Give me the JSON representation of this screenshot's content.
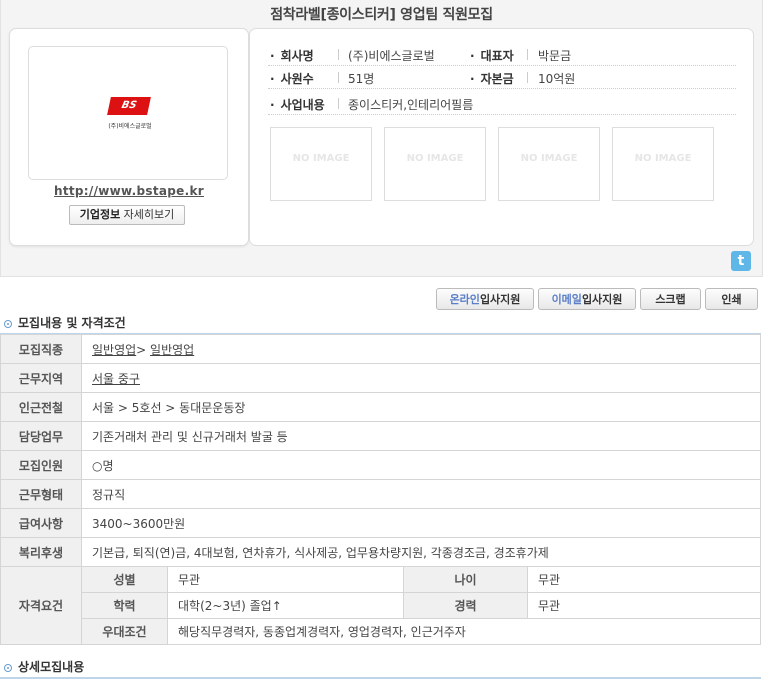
{
  "page": {
    "title": "점착라벨[종이스티커] 영업팀 직원모집"
  },
  "company": {
    "logo_mark": "BS",
    "logo_text": "(주)비에스글로벌",
    "homepage": "http://www.bstape.kr",
    "detail_button_bold": "기업정보",
    "detail_button_rest": " 자세히보기",
    "fields": [
      {
        "label": "회사명",
        "value": "(주)비에스글로벌"
      },
      {
        "label": "대표자",
        "value": "박문금"
      },
      {
        "label": "사원수",
        "value": "51명"
      },
      {
        "label": "자본금",
        "value": "10억원"
      },
      {
        "label": "사업내용",
        "value": "종이스티커,인테리어필름"
      }
    ],
    "no_image_text": "NO IMAGE"
  },
  "share": {
    "twitter_glyph": "t"
  },
  "actions": {
    "online_hl": "온라인",
    "online_rest": "입사지원",
    "email_hl": "이메일",
    "email_rest": "입사지원",
    "scrap": "스크랩",
    "print": "인쇄"
  },
  "sections": {
    "requirements_title": "모집내용 및 자격조건",
    "detail_title": "상세모집내용"
  },
  "requirements": {
    "job_label": "모집직종",
    "job_value_1": "일반영업",
    "job_sep": "> ",
    "job_value_2": "일반영업",
    "location_label": "근무지역",
    "location_value": "서울 중구",
    "station_label": "인근전철",
    "station_value": "서울 > 5호선 > 동대문운동장",
    "duty_label": "담당업무",
    "duty_value": "기존거래처 관리 및 신규거래처 발굴 등",
    "headcount_label": "모집인원",
    "headcount_value": "○명",
    "type_label": "근무형태",
    "type_value": "정규직",
    "salary_label": "급여사항",
    "salary_value": "3400~3600만원",
    "welfare_label": "복리후생",
    "welfare_value": "기본급, 퇴직(연)금, 4대보험, 연차휴가, 식사제공, 업무용차량지원, 각종경조금, 경조휴가제",
    "qual_label": "자격요건",
    "gender_label": "성별",
    "gender_value": "무관",
    "age_label": "나이",
    "age_value": "무관",
    "edu_label": "학력",
    "edu_value": "대학(2~3년) 졸업↑",
    "exp_label": "경력",
    "exp_value": "무관",
    "pref_label": "우대조건",
    "pref_value": "해당직무경력자, 동종업계경력자, 영업경력자, 인근거주자"
  }
}
